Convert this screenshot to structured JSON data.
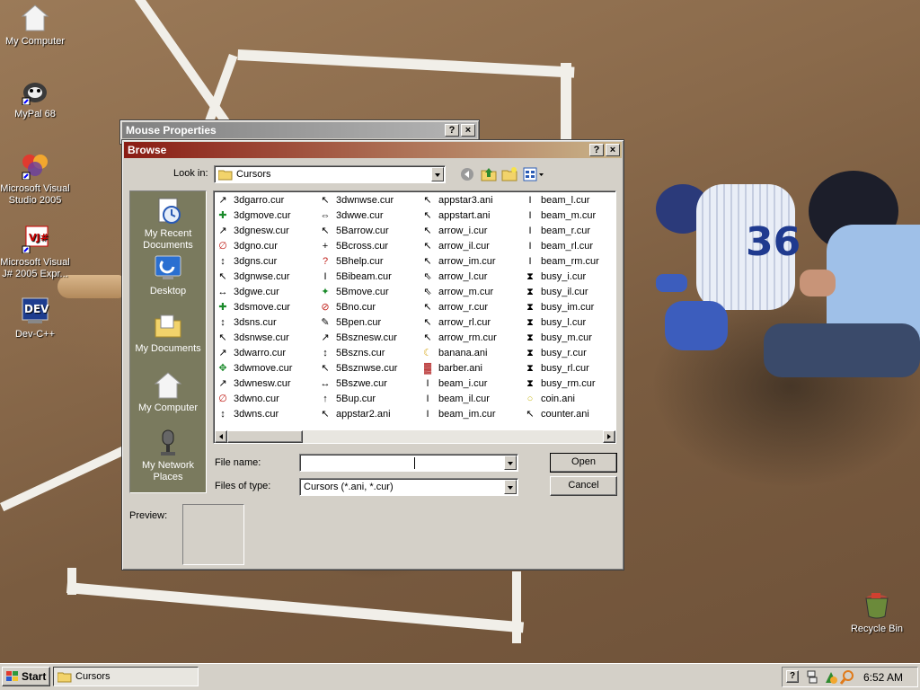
{
  "desktop": {
    "icons": [
      {
        "label": "My Computer",
        "icon": "my-computer-icon"
      },
      {
        "label": "MyPal 68",
        "icon": "mypal-icon"
      },
      {
        "label": "Microsoft Visual Studio 2005",
        "icon": "visual-studio-icon"
      },
      {
        "label": "Microsoft Visual J# 2005 Expr...",
        "icon": "visual-j-sharp-icon"
      },
      {
        "label": "Dev-C++",
        "icon": "dev-cpp-icon"
      },
      {
        "label": "Recycle Bin",
        "icon": "recycle-bin-icon"
      }
    ]
  },
  "mouse_properties": {
    "title": "Mouse Properties",
    "help_btn": "?",
    "close_btn": "×"
  },
  "browse": {
    "title": "Browse",
    "help_btn": "?",
    "close_btn": "×",
    "look_in_label": "Look in:",
    "look_in_value": "Cursors",
    "places": [
      {
        "label": "My Recent Documents",
        "icon": "recent-documents-icon"
      },
      {
        "label": "Desktop",
        "icon": "desktop-icon"
      },
      {
        "label": "My Documents",
        "icon": "my-documents-icon"
      },
      {
        "label": "My Computer",
        "icon": "my-computer-icon"
      },
      {
        "label": "My Network Places",
        "icon": "network-places-icon"
      }
    ],
    "files": {
      "col1": [
        "3dgarro.cur",
        "3dgmove.cur",
        "3dgnesw.cur",
        "3dgno.cur",
        "3dgns.cur",
        "3dgnwse.cur",
        "3dgwe.cur",
        "3dsmove.cur",
        "3dsns.cur",
        "3dsnwse.cur",
        "3dwarro.cur",
        "3dwmove.cur",
        "3dwnesw.cur",
        "3dwno.cur",
        "3dwns.cur"
      ],
      "col2": [
        "3dwnwse.cur",
        "3dwwe.cur",
        "5Barrow.cur",
        "5Bcross.cur",
        "5Bhelp.cur",
        "5Bibeam.cur",
        "5Bmove.cur",
        "5Bno.cur",
        "5Bpen.cur",
        "5Bsznesw.cur",
        "5Bszns.cur",
        "5Bsznwse.cur",
        "5Bszwe.cur",
        "5Bup.cur",
        "appstar2.ani"
      ],
      "col3": [
        "appstar3.ani",
        "appstart.ani",
        "arrow_i.cur",
        "arrow_il.cur",
        "arrow_im.cur",
        "arrow_l.cur",
        "arrow_m.cur",
        "arrow_r.cur",
        "arrow_rl.cur",
        "arrow_rm.cur",
        "banana.ani",
        "barber.ani",
        "beam_i.cur",
        "beam_il.cur",
        "beam_im.cur"
      ],
      "col4": [
        "beam_l.cur",
        "beam_m.cur",
        "beam_r.cur",
        "beam_rl.cur",
        "beam_rm.cur",
        "busy_i.cur",
        "busy_il.cur",
        "busy_im.cur",
        "busy_l.cur",
        "busy_m.cur",
        "busy_r.cur",
        "busy_rl.cur",
        "busy_rm.cur",
        "coin.ani",
        "counter.ani"
      ]
    },
    "file_name_label": "File name:",
    "file_name_value": "",
    "files_of_type_label": "Files of type:",
    "files_of_type_value": "Cursors (*.ani, *.cur)",
    "open_btn": "Open",
    "cancel_btn": "Cancel",
    "preview_label": "Preview:"
  },
  "taskbar": {
    "start_label": "Start",
    "task_label": "Cursors",
    "clock": "6:52 AM"
  }
}
